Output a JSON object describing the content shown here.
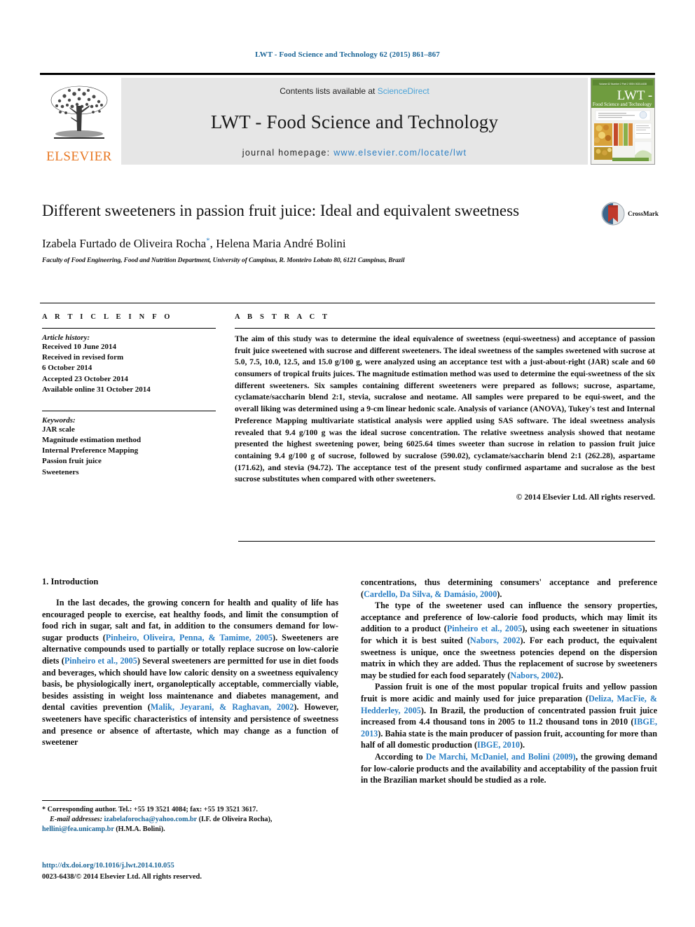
{
  "running_head": "LWT - Food Science and Technology 62 (2015) 861–867",
  "masthead": {
    "contents_prefix": "Contents lists available at",
    "sciencedirect": "ScienceDirect",
    "journal_name": "LWT - Food Science and Technology",
    "homepage_label": "journal homepage:",
    "homepage_url": "www.elsevier.com/locate/lwt",
    "publisher": "ELSEVIER",
    "cover_title": "LWT -",
    "cover_subtitle": "Food Science and Technology",
    "cover_top_left": "Volume 62 Number 2 Part 2  June 2015",
    "cover_top_right": "ISSN 0023-6438"
  },
  "article": {
    "title": "Different sweeteners in passion fruit juice: Ideal and equivalent sweetness",
    "authors": "Izabela Furtado de Oliveira Rocha, Helena Maria André Bolini",
    "author_marker": "*",
    "affiliation": "Faculty of Food Engineering, Food and Nutrition Department, University of Campinas, R. Monteiro Lobato 80, 6121 Campinas, Brazil",
    "crossmark_label": "CrossMark"
  },
  "article_info": {
    "heading": "A R T I C L E   I N F O",
    "history_label": "Article history:",
    "history": [
      "Received 10 June 2014",
      "Received in revised form",
      "6 October 2014",
      "Accepted 23 October 2014",
      "Available online 31 October 2014"
    ],
    "keywords_label": "Keywords:",
    "keywords": [
      "JAR scale",
      "Magnitude estimation method",
      "Internal Preference Mapping",
      "Passion fruit juice",
      "Sweeteners"
    ]
  },
  "abstract": {
    "heading": "A B S T R A C T",
    "text": "The aim of this study was to determine the ideal equivalence of sweetness (equi-sweetness) and acceptance of passion fruit juice sweetened with sucrose and different sweeteners. The ideal sweetness of the samples sweetened with sucrose at 5.0, 7.5, 10.0, 12.5, and 15.0 g/100 g, were analyzed using an acceptance test with a just-about-right (JAR) scale and 60 consumers of tropical fruits juices. The magnitude estimation method was used to determine the equi-sweetness of the six different sweeteners. Six samples containing different sweeteners were prepared as follows; sucrose, aspartame, cyclamate/saccharin blend 2:1, stevia, sucralose and neotame. All samples were prepared to be equi-sweet, and the overall liking was determined using a 9-cm linear hedonic scale. Analysis of variance (ANOVA), Tukey's test and Internal Preference Mapping multivariate statistical analysis were applied using SAS software. The ideal sweetness analysis revealed that 9.4 g/100 g was the ideal sucrose concentration. The relative sweetness analysis showed that neotame presented the highest sweetening power, being 6025.64 times sweeter than sucrose in relation to passion fruit juice containing 9.4 g/100 g of sucrose, followed by sucralose (590.02), cyclamate/saccharin blend 2:1 (262.28), aspartame (171.62), and stevia (94.72). The acceptance test of the present study confirmed aspartame and sucralose as the best sucrose substitutes when compared with other sweeteners.",
    "copyright": "© 2014 Elsevier Ltd. All rights reserved."
  },
  "introduction": {
    "heading": "1. Introduction",
    "left_paragraphs": [
      {
        "parts": [
          {
            "t": "In the last decades, the growing concern for health and quality of life has encouraged people to exercise, eat healthy foods, and limit the consumption of food rich in sugar, salt and fat, in addition to the consumers demand for low-sugar products (",
            "ref": false
          },
          {
            "t": "Pinheiro, Oliveira, Penna, & Tamime, 2005",
            "ref": true
          },
          {
            "t": "). Sweeteners are alternative compounds used to partially or totally replace sucrose on low-calorie diets (",
            "ref": false
          },
          {
            "t": "Pinheiro et al., 2005",
            "ref": true
          },
          {
            "t": ") Several sweeteners are permitted for use in diet foods and beverages, which should have low caloric density on a sweetness equivalency basis, be physiologically inert, organoleptically acceptable, commercially viable, besides assisting in weight loss maintenance and diabetes management, and dental cavities prevention (",
            "ref": false
          },
          {
            "t": "Malik, Jeyarani, & Raghavan, 2002",
            "ref": true
          },
          {
            "t": "). However, sweeteners have specific characteristics of intensity and persistence of sweetness and presence or absence of aftertaste, which may change as a function of sweetener",
            "ref": false
          }
        ]
      }
    ],
    "right_paragraphs": [
      {
        "continued": true,
        "parts": [
          {
            "t": "concentrations, thus determining consumers' acceptance and preference (",
            "ref": false
          },
          {
            "t": "Cardello, Da Silva, & Damásio, 2000",
            "ref": true
          },
          {
            "t": ").",
            "ref": false
          }
        ]
      },
      {
        "parts": [
          {
            "t": "The type of the sweetener used can influence the sensory properties, acceptance and preference of low-calorie food products, which may limit its addition to a product (",
            "ref": false
          },
          {
            "t": "Pinheiro et al., 2005",
            "ref": true
          },
          {
            "t": "), using each sweetener in situations for which it is best suited (",
            "ref": false
          },
          {
            "t": "Nabors, 2002",
            "ref": true
          },
          {
            "t": "). For each product, the equivalent sweetness is unique, once the sweetness potencies depend on the dispersion matrix in which they are added. Thus the replacement of sucrose by sweeteners may be studied for each food separately (",
            "ref": false
          },
          {
            "t": "Nabors, 2002",
            "ref": true
          },
          {
            "t": ").",
            "ref": false
          }
        ]
      },
      {
        "parts": [
          {
            "t": "Passion fruit is one of the most popular tropical fruits and yellow passion fruit is more acidic and mainly used for juice preparation (",
            "ref": false
          },
          {
            "t": "Deliza, MacFie, & Hedderley, 2005",
            "ref": true
          },
          {
            "t": "). In Brazil, the production of concentrated passion fruit juice increased from 4.4 thousand tons in 2005 to 11.2 thousand tons in 2010 (",
            "ref": false
          },
          {
            "t": "IBGE, 2013",
            "ref": true
          },
          {
            "t": "). Bahia state is the main producer of passion fruit, accounting for more than half of all domestic production (",
            "ref": false
          },
          {
            "t": "IBGE, 2010",
            "ref": true
          },
          {
            "t": ").",
            "ref": false
          }
        ]
      },
      {
        "parts": [
          {
            "t": "According to ",
            "ref": false
          },
          {
            "t": "De Marchi, McDaniel, and Bolini (2009)",
            "ref": true
          },
          {
            "t": ", the growing demand for low-calorie products and the availability and acceptability of the passion fruit in the Brazilian market should be studied as a role.",
            "ref": false
          }
        ]
      }
    ]
  },
  "footnotes": {
    "marker": "*",
    "corresponding": "Corresponding author. Tel.: +55 19 3521 4084; fax: +55 19 3521 3617.",
    "email_label": "E-mail addresses:",
    "email1": "izabelaforocha@yahoo.com.br",
    "email1_owner": "(I.F. de Oliveira Rocha),",
    "email2": "hellini@fea.unicamp.br",
    "email2_owner": "(H.M.A. Bolini).",
    "doi": "http://dx.doi.org/10.1016/j.lwt.2014.10.055",
    "issn_line": "0023-6438/© 2014 Elsevier Ltd. All rights reserved."
  },
  "colors": {
    "link_blue": "#2b7fc4",
    "head_blue": "#1a6496",
    "elsevier_orange": "#E87722",
    "banner_gray": "#e6e6e6"
  }
}
